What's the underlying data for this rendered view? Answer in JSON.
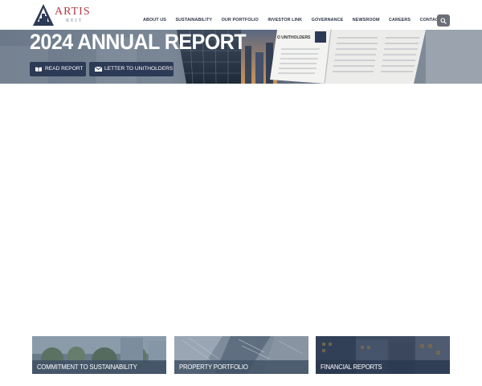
{
  "brand": {
    "name": "ARTIS",
    "sub": "REIT",
    "accent": "#b23a48",
    "navy": "#2d3a56"
  },
  "nav": {
    "items": [
      {
        "label": "ABOUT US"
      },
      {
        "label": "SUSTAINABILITY"
      },
      {
        "label": "OUR PORTFOLIO"
      },
      {
        "label": "INVESTOR LINK"
      },
      {
        "label": "GOVERNANCE"
      },
      {
        "label": "NEWSROOM"
      },
      {
        "label": "CAREERS"
      },
      {
        "label": "CONTACT"
      }
    ],
    "search_icon": "search-icon"
  },
  "hero": {
    "title": "2024 ANNUAL REPORT",
    "report_page_heading": "O UNITHOLDERS",
    "buttons": {
      "read_report": {
        "label": "READ REPORT",
        "icon": "book-icon"
      },
      "letter": {
        "label": "LETTER TO UNITHOLDERS",
        "icon": "envelope-icon"
      }
    }
  },
  "cards": [
    {
      "label": "COMMITMENT TO SUSTAINABILITY"
    },
    {
      "label": "PROPERTY PORTFOLIO"
    },
    {
      "label": "FINANCIAL REPORTS"
    }
  ]
}
